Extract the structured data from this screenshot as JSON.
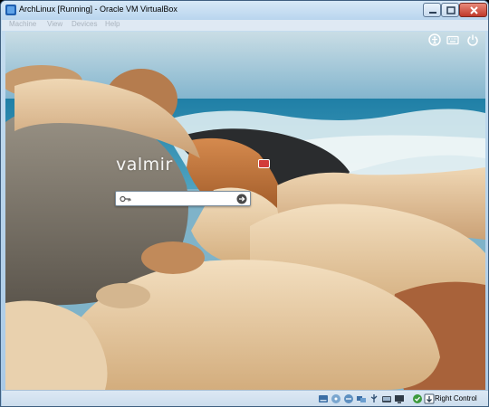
{
  "window": {
    "title": "ArchLinux [Running] - Oracle VM VirtualBox"
  },
  "menu": {
    "items": [
      "Machine",
      "View",
      "Devices",
      "Help"
    ]
  },
  "login": {
    "username": "valmir",
    "password_value": ""
  },
  "statusbar": {
    "host_key_label": "Right Control",
    "icons": [
      "hard-disk-icon",
      "optical-drive-icon",
      "floppy-icon",
      "network-icon",
      "usb-icon",
      "shared-folders-icon",
      "display-icon",
      "capture-icon",
      "mouse-integration-icon",
      "host-key-arrow-icon"
    ]
  },
  "colors": {
    "titlebar": "#c6def0",
    "close_button": "#c0392b",
    "badge": "#d23b3b"
  }
}
